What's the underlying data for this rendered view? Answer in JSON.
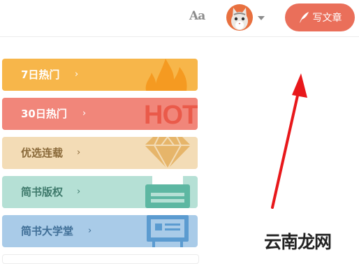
{
  "header": {
    "font_toggle_label": "Aa",
    "write_button_label": "写文章",
    "accent_color": "#ea6f5a"
  },
  "cards": [
    {
      "label": "7日热门",
      "arrow": "›",
      "color": "#f7b64a",
      "icon": "flame-icon"
    },
    {
      "label": "30日热门",
      "arrow": "›",
      "color": "#f1867a",
      "icon": "hot-text-icon"
    },
    {
      "label": "优选连载",
      "arrow": "›",
      "color": "#f3dcb6",
      "icon": "diamond-icon"
    },
    {
      "label": "简书版权",
      "arrow": "›",
      "color": "#b5e0d5",
      "icon": "typewriter-icon"
    },
    {
      "label": "简书大学堂",
      "arrow": "›",
      "color": "#a9cbe8",
      "icon": "blackboard-icon"
    }
  ],
  "hot_icon_text": "HOT",
  "watermark": "云南龙网"
}
